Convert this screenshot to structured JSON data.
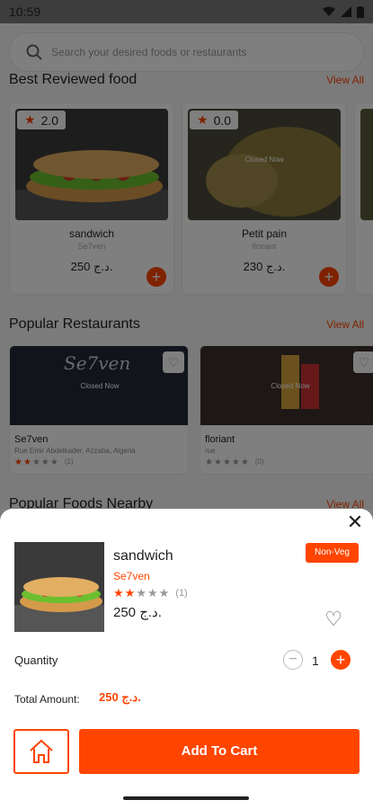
{
  "status_bar": {
    "time": "10:59"
  },
  "search": {
    "placeholder": "Search your desired foods or restaurants"
  },
  "sections": {
    "best_reviewed": {
      "title": "Best Reviewed food",
      "view_all": "View All"
    },
    "popular_restaurants": {
      "title": "Popular Restaurants",
      "view_all": "View All"
    },
    "popular_nearby": {
      "title": "Popular Foods Nearby",
      "view_all": "View All"
    }
  },
  "foods": [
    {
      "rating": "2.0",
      "name": "sandwich",
      "restaurant": "Se7ven",
      "price": "250 د.ج.",
      "closed_label": ""
    },
    {
      "rating": "0.0",
      "name": "Petit pain",
      "restaurant": "floriant",
      "price": "230 د.ج.",
      "closed_label": "Closed Now"
    }
  ],
  "restaurants": [
    {
      "name": "Se7ven",
      "address": "Rue Emir Abdelkader, Azzaba, Algeria",
      "rating_count": "(1)",
      "stars": 2,
      "closed_label": "Closed Now",
      "logo_text": "Se7ven"
    },
    {
      "name": "floriant",
      "address": "rue",
      "rating_count": "(0)",
      "stars": 0,
      "closed_label": "Closed Now"
    }
  ],
  "product_sheet": {
    "name": "sandwich",
    "restaurant": "Se7ven",
    "stars": 2,
    "rating_count": "(1)",
    "price": "250 د.ج.",
    "badge": "Non-Veg",
    "quantity_label": "Quantity",
    "quantity": "1",
    "minus": "−",
    "plus": "+",
    "total_label": "Total Amount:",
    "total_value": "250 د.ج.",
    "add_to_cart": "Add To Cart",
    "close": "✕"
  },
  "colors": {
    "accent": "#ff4500",
    "overlay": "rgba(0,0,0,0.5)"
  },
  "icons": [
    "search-icon",
    "star-icon",
    "heart-icon",
    "close-icon",
    "home-icon",
    "plus-icon",
    "minus-icon"
  ]
}
